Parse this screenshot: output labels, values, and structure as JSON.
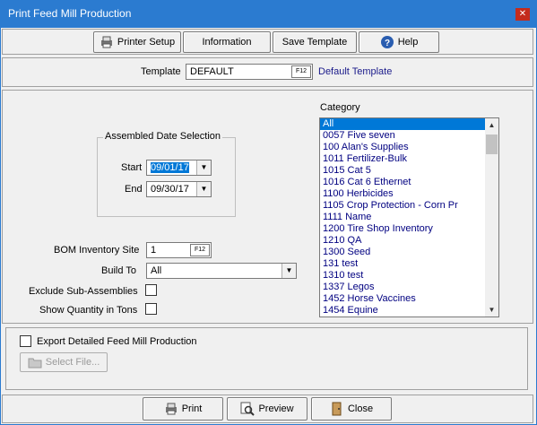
{
  "window": {
    "title": "Print Feed Mill Production",
    "close_glyph": "✕"
  },
  "toolbar": {
    "printer_setup": "Printer Setup",
    "information": "Information",
    "save_template": "Save Template",
    "help": "Help"
  },
  "template": {
    "label": "Template",
    "value": "DEFAULT",
    "f12": "F12",
    "description": "Default Template"
  },
  "date_selection": {
    "caption": "Assembled Date Selection",
    "start_label": "Start",
    "start_value": "09/01/17",
    "end_label": "End",
    "end_value": "09/30/17"
  },
  "options": {
    "bom_site_label": "BOM Inventory Site",
    "bom_site_value": "1",
    "bom_f12": "F12",
    "build_to_label": "Build To",
    "build_to_value": "All",
    "exclude_label": "Exclude Sub-Assemblies",
    "exclude_checked": false,
    "show_tons_label": "Show Quantity in Tons",
    "show_tons_checked": false
  },
  "category": {
    "label": "Category",
    "items": [
      "All",
      "0057 Five seven",
      "100 Alan's Supplies",
      "1011 Fertilizer-Bulk",
      "1015 Cat 5",
      "1016 Cat 6 Ethernet",
      "1100 Herbicides",
      "1105 Crop Protection - Corn Pr",
      "1111 Name",
      "1200 Tire Shop Inventory",
      "1210 QA",
      "1300 Seed",
      "131 test",
      "1310 test",
      "1337 Legos",
      "1452 Horse Vaccines",
      "1454 Equine"
    ],
    "selected_index": 0
  },
  "export": {
    "label": "Export Detailed Feed Mill Production",
    "checked": false,
    "select_file": "Select File..."
  },
  "footer": {
    "print": "Print",
    "preview": "Preview",
    "close": "Close"
  },
  "colors": {
    "titlebar": "#2b7bd0",
    "selection": "#0078d7",
    "list_text": "#000080"
  }
}
